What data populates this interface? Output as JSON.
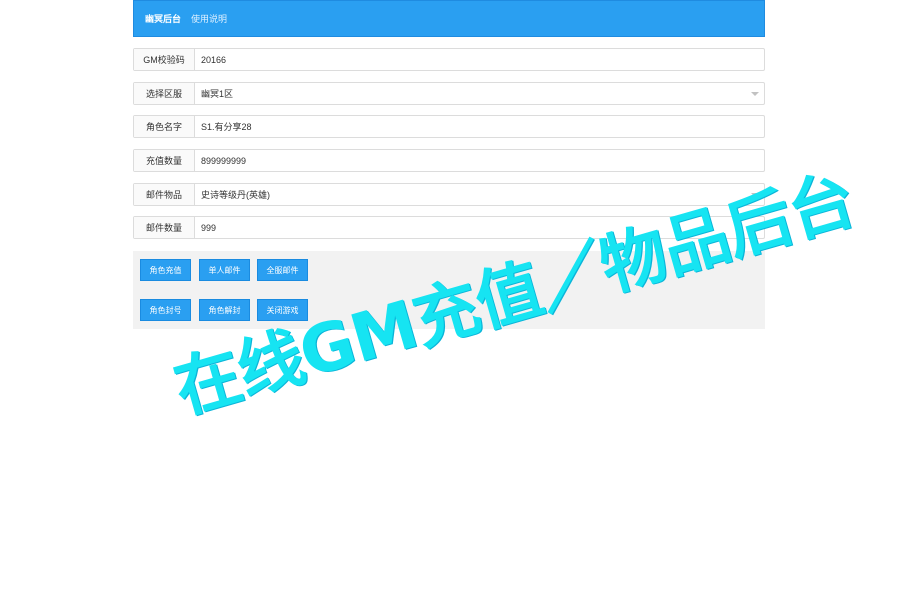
{
  "nav": {
    "brand": "幽冥后台",
    "help_link": "使用说明"
  },
  "form": [
    {
      "label": "GM校验码",
      "value": "20166",
      "type": "text"
    },
    {
      "label": "选择区服",
      "value": "幽冥1区",
      "type": "select"
    },
    {
      "label": "角色名字",
      "value": "S1.有分享28",
      "type": "text"
    },
    {
      "label": "充值数量",
      "value": "899999999",
      "type": "text"
    },
    {
      "label": "邮件物品",
      "value": "史诗等级丹(英雄)",
      "type": "select"
    },
    {
      "label": "邮件数量",
      "value": "999",
      "type": "text"
    }
  ],
  "buttons": {
    "recharge": "角色充值",
    "single_mail": "单人邮件",
    "all_mail": "全服邮件",
    "ban": "角色封号",
    "unban": "角色解封",
    "close_server": "关闭游戏"
  },
  "colors": {
    "primary": "#2a9ff1",
    "watermark": "#16e4f2"
  },
  "watermark": {
    "text": "在线GM充值／物品后台"
  }
}
